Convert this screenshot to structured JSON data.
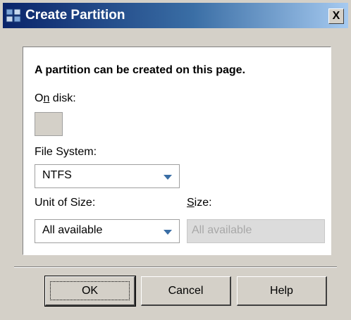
{
  "window": {
    "title": "Create Partition",
    "close_label": "X"
  },
  "panel": {
    "heading": "A partition can be created on this page.",
    "on_disk": {
      "label_before": "O",
      "label_mnemonic": "n",
      "label_after": " disk:"
    },
    "file_system": {
      "label": "File System:",
      "selected": "NTFS"
    },
    "unit_of_size": {
      "label": "Unit of Size:",
      "selected": "All available"
    },
    "size": {
      "label_mnemonic": "S",
      "label_after": "ize:",
      "value": "All available"
    }
  },
  "buttons": {
    "ok": "OK",
    "cancel": "Cancel",
    "help": "Help"
  },
  "colors": {
    "titlebar_start": "#0a246a",
    "titlebar_end": "#a6caf0",
    "dialog_background": "#d4d0c8",
    "combo_arrow": "#3a6ea5"
  }
}
